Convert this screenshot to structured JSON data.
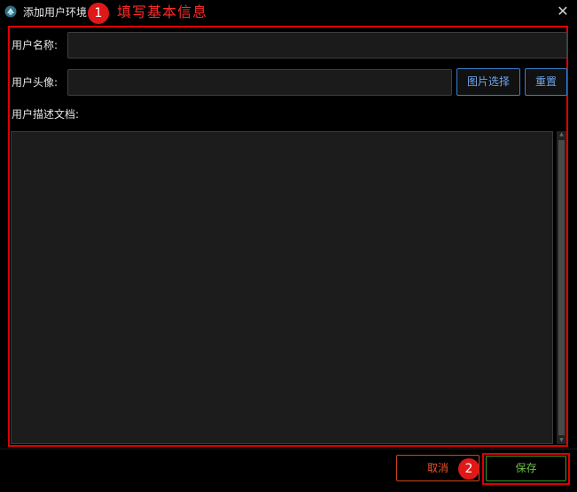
{
  "window": {
    "title": "添加用户环境",
    "close_glyph": "✕"
  },
  "annotations": {
    "step1_number": "1",
    "step1_text": "填写基本信息",
    "step2_number": "2",
    "color": "#ff2a2a"
  },
  "form": {
    "name_label": "用户名称:",
    "name_value": "",
    "avatar_label": "用户头像:",
    "avatar_value": "",
    "choose_image_button": "图片选择",
    "reset_button": "重置",
    "description_label": "用户描述文档:",
    "description_value": ""
  },
  "footer": {
    "cancel_button": "取消",
    "save_button": "保存"
  },
  "colors": {
    "background": "#000000",
    "input_bg": "#1b1b1b",
    "blue_accent": "#3b7fd1",
    "cancel_accent": "#d0451c",
    "save_accent": "#3b9a2c"
  }
}
